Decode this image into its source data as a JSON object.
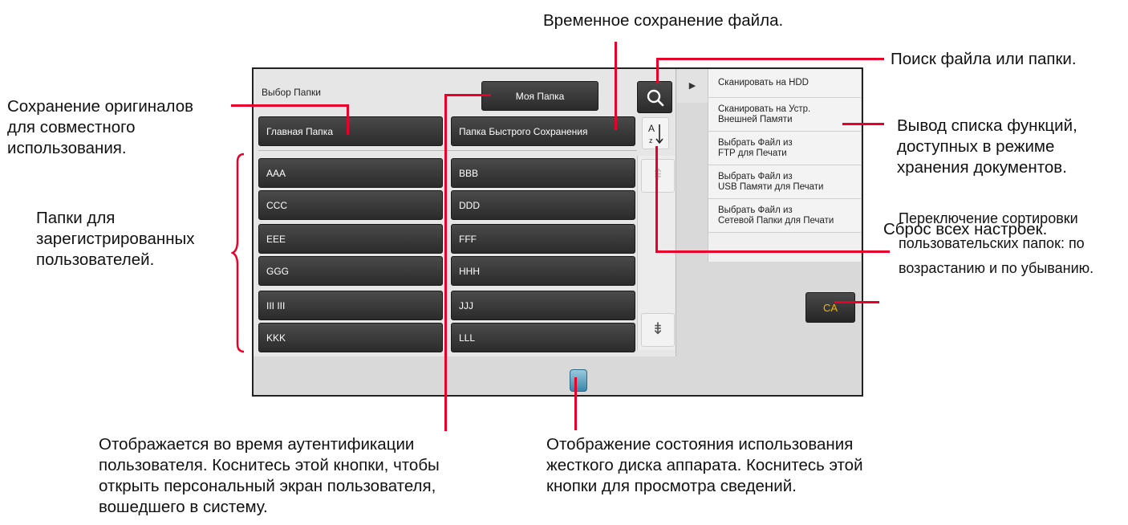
{
  "callouts": {
    "temp_save": "Временное сохранение файла.",
    "search": "Поиск файла или папки.",
    "shared": "Сохранение оригиналов\nдля совместного\nиспользования.",
    "functions": "Вывод списка функций,\nдоступных в режиме\nхранения документов.",
    "users": "Папки для\nзарегистрированных\nпользователей.",
    "sort": "Переключение сортировки\nпользовательских папок: по\nвозрастанию и по убыванию.",
    "reset": "Сброс всех настроек.",
    "my_folder": "Отображается во время аутентификации\nпользователя. Коснитесь этой кнопки, чтобы\nоткрыть персональный экран пользователя,\nвошедшего в систему.",
    "hdd": "Отображение состояния использования\nжесткого диска аппарата. Коснитесь этой\nкнопки для просмотра сведений."
  },
  "panel": {
    "label": "Выбор Папки",
    "my_folder": "Моя Папка",
    "main_folder": "Главная Папка",
    "quick_folder": "Папка Быстрого Сохранения"
  },
  "folders": [
    "AAA",
    "BBB",
    "CCC",
    "DDD",
    "EEE",
    "FFF",
    "GGG",
    "HHH",
    "III III",
    "JJJ",
    "KKK",
    "LLL"
  ],
  "functions": [
    "Сканировать на HDD",
    "Сканировать на Устр.\nВнешней Памяти",
    "Выбрать Файл из\nFTP для Печати",
    "Выбрать Файл из\nUSB Памяти для Печати",
    "Выбрать Файл из\nСетевой Папки для Печати"
  ],
  "ca_label": "CA",
  "sort_icon": "A↓Z",
  "icons": {
    "search": "search-icon",
    "hdd": "hdd-status-icon",
    "scroll_up": "chevron-up-icon",
    "scroll_down": "chevron-down-icon"
  }
}
